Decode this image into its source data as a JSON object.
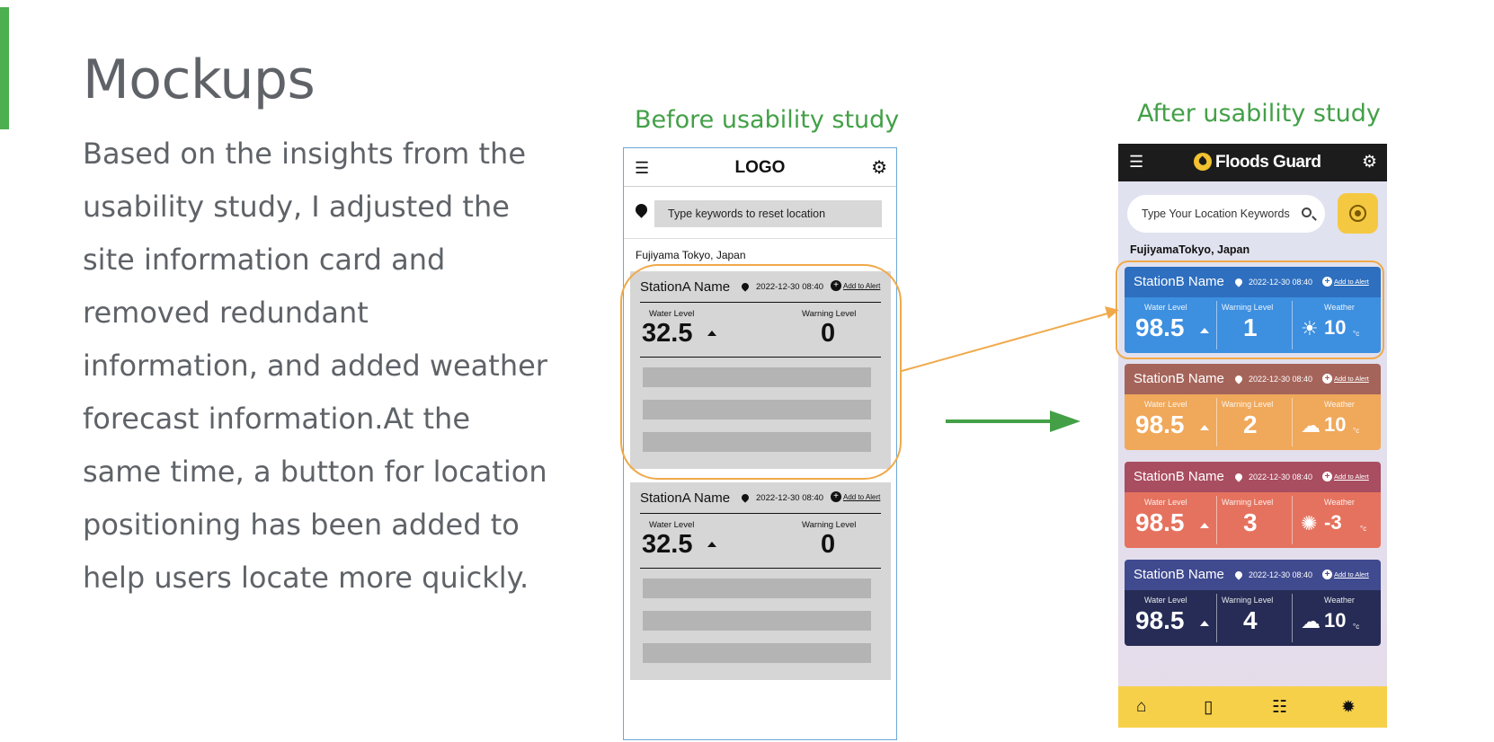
{
  "slide": {
    "title": "Mockups",
    "body": "Based on the insights from the usability study, I adjusted the site information card and removed redundant information, and added weather forecast information.At the same time, a button for location positioning has been added to help users locate more quickly.",
    "before_caption": "Before usability study",
    "after_caption": "After usability study",
    "colors": {
      "accent": "#4caf50",
      "caption": "#43a047",
      "highlight": "#f0a94a"
    }
  },
  "before": {
    "logo": "LOGO",
    "search_placeholder": "Type keywords to reset location",
    "location": "Fujiyama  Tokyo, Japan",
    "cards": [
      {
        "station": "StationA Name",
        "date": "2022-12-30 08:40",
        "alert": "Add to Alert",
        "water_label": "Water Level",
        "water_value": "32.5",
        "warning_label": "Warning Level",
        "warning_value": "0"
      },
      {
        "station": "StationA Name",
        "date": "2022-12-30 08:40",
        "alert": "Add to Alert",
        "water_label": "Water Level",
        "water_value": "32.5",
        "warning_label": "Warning Level",
        "warning_value": "0"
      }
    ]
  },
  "after": {
    "app_name": "Floods Guard",
    "search_placeholder": "Type Your Location Keywords",
    "location": "FujiyamaTokyo, Japan",
    "cards": [
      {
        "station": "StationB Name",
        "date": "2022-12-30 08:40",
        "alert": "Add to Alert",
        "water_label": "Water Level",
        "water_value": "98.5",
        "warning_label": "Warning Level",
        "warning_value": "1",
        "weather_label": "Weather",
        "weather_icon": "sun-icon",
        "temp": "10",
        "unit": "°c",
        "top_color": "#2e6fbf",
        "bottom_color": "#3d8fe0"
      },
      {
        "station": "StationB Name",
        "date": "2022-12-30 08:40",
        "alert": "Add to Alert",
        "water_label": "Water Level",
        "water_value": "98.5",
        "warning_label": "Warning Level",
        "warning_value": "2",
        "weather_label": "Weather",
        "weather_icon": "rain-cloud-icon",
        "temp": "10",
        "unit": "°c",
        "top_color": "#a5645a",
        "bottom_color": "#f0a85a"
      },
      {
        "station": "StationB Name",
        "date": "2022-12-30 08:40",
        "alert": "Add to Alert",
        "water_label": "Water Level",
        "water_value": "98.5",
        "warning_label": "Warning Level",
        "warning_value": "3",
        "weather_label": "Weather",
        "weather_icon": "snowflake-icon",
        "temp": "-3",
        "unit": "°c",
        "top_color": "#a94d60",
        "bottom_color": "#e5725e"
      },
      {
        "station": "StationB Name",
        "date": "2022-12-30 08:40",
        "alert": "Add to Alert",
        "water_label": "Water Level",
        "water_value": "98.5",
        "warning_label": "Warning Level",
        "warning_value": "4",
        "weather_label": "Weather",
        "weather_icon": "rain-cloud-icon",
        "temp": "10",
        "unit": "°c",
        "top_color": "#3f4a8f",
        "bottom_color": "#262c55"
      }
    ],
    "nav": [
      "home-icon",
      "map-icon",
      "list-icon",
      "alert-icon"
    ]
  }
}
